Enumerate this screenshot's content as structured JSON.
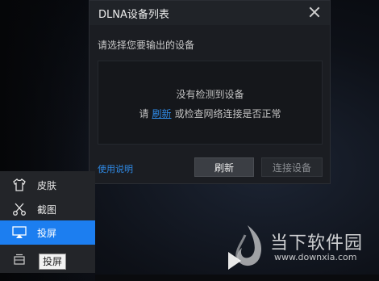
{
  "dialog": {
    "title": "DLNA设备列表",
    "prompt": "请选择您要输出的设备",
    "empty_message": "没有检测到设备",
    "hint_prefix": "请",
    "hint_link": "刷新",
    "hint_suffix": "或检查网络连接是否正常",
    "help_link": "使用说明",
    "refresh_button": "刷新",
    "connect_button": "连接设备"
  },
  "menu": {
    "items": [
      {
        "label": "皮肤",
        "icon": "shirt-icon"
      },
      {
        "label": "截图",
        "icon": "scissors-icon"
      },
      {
        "label": "投屏",
        "icon": "cast-screen-icon",
        "active": true
      }
    ],
    "tooltip": "投屏",
    "tooltip_icon": "screen-stack-icon"
  },
  "watermark": {
    "name": "当下软件园",
    "url": "www.downxia.com"
  },
  "colors": {
    "accent": "#1c7ef0",
    "link": "#2f8ae6",
    "dialog_bg": "#1b1d22"
  }
}
